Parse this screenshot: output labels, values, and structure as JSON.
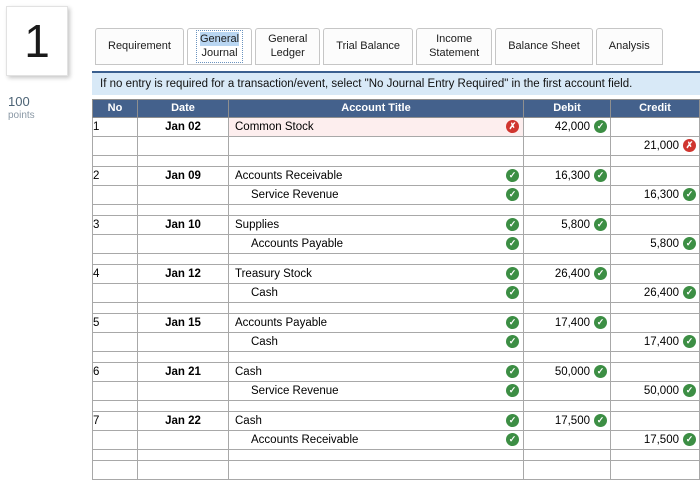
{
  "sidebar": {
    "question_number": "1",
    "points_value": "100",
    "points_label": "points"
  },
  "tabs": {
    "items": [
      {
        "label": "Requirement",
        "selected": false,
        "two_line": false
      },
      {
        "label": "General Journal",
        "selected": true,
        "two_line": true
      },
      {
        "label": "General Ledger",
        "selected": false,
        "two_line": true
      },
      {
        "label": "Trial Balance",
        "selected": false,
        "two_line": false
      },
      {
        "label": "Income Statement",
        "selected": false,
        "two_line": true
      },
      {
        "label": "Balance Sheet",
        "selected": false,
        "two_line": false
      },
      {
        "label": "Analysis",
        "selected": false,
        "two_line": false
      }
    ]
  },
  "notice": {
    "text": "If no entry is required for a transaction/event, select \"No Journal Entry Required\" in the first account field."
  },
  "journal": {
    "columns": [
      "No",
      "Date",
      "Account Title",
      "Debit",
      "Credit"
    ],
    "icons": {
      "ok": "✓",
      "error": "✗"
    },
    "rows": [
      {
        "no": "1",
        "date": "Jan 02",
        "account": "Common Stock",
        "indent": false,
        "account_icon": "error",
        "account_error": true,
        "debit": "42,000",
        "debit_icon": "ok",
        "credit": "",
        "credit_icon": ""
      },
      {
        "no": "",
        "date": "",
        "account": "",
        "indent": false,
        "account_icon": "",
        "account_error": false,
        "debit": "",
        "debit_icon": "",
        "credit": "21,000",
        "credit_icon": "error"
      },
      {
        "type": "spacer"
      },
      {
        "no": "2",
        "date": "Jan 09",
        "account": "Accounts Receivable",
        "indent": false,
        "account_icon": "ok",
        "account_error": false,
        "debit": "16,300",
        "debit_icon": "ok",
        "credit": "",
        "credit_icon": ""
      },
      {
        "no": "",
        "date": "",
        "account": "Service Revenue",
        "indent": true,
        "account_icon": "ok",
        "account_error": false,
        "debit": "",
        "debit_icon": "",
        "credit": "16,300",
        "credit_icon": "ok"
      },
      {
        "type": "spacer"
      },
      {
        "no": "3",
        "date": "Jan 10",
        "account": "Supplies",
        "indent": false,
        "account_icon": "ok",
        "account_error": false,
        "debit": "5,800",
        "debit_icon": "ok",
        "credit": "",
        "credit_icon": ""
      },
      {
        "no": "",
        "date": "",
        "account": "Accounts Payable",
        "indent": true,
        "account_icon": "ok",
        "account_error": false,
        "debit": "",
        "debit_icon": "",
        "credit": "5,800",
        "credit_icon": "ok"
      },
      {
        "type": "spacer"
      },
      {
        "no": "4",
        "date": "Jan 12",
        "account": "Treasury Stock",
        "indent": false,
        "account_icon": "ok",
        "account_error": false,
        "debit": "26,400",
        "debit_icon": "ok",
        "credit": "",
        "credit_icon": ""
      },
      {
        "no": "",
        "date": "",
        "account": "Cash",
        "indent": true,
        "account_icon": "ok",
        "account_error": false,
        "debit": "",
        "debit_icon": "",
        "credit": "26,400",
        "credit_icon": "ok"
      },
      {
        "type": "spacer"
      },
      {
        "no": "5",
        "date": "Jan 15",
        "account": "Accounts Payable",
        "indent": false,
        "account_icon": "ok",
        "account_error": false,
        "debit": "17,400",
        "debit_icon": "ok",
        "credit": "",
        "credit_icon": ""
      },
      {
        "no": "",
        "date": "",
        "account": "Cash",
        "indent": true,
        "account_icon": "ok",
        "account_error": false,
        "debit": "",
        "debit_icon": "",
        "credit": "17,400",
        "credit_icon": "ok"
      },
      {
        "type": "spacer"
      },
      {
        "no": "6",
        "date": "Jan 21",
        "account": "Cash",
        "indent": false,
        "account_icon": "ok",
        "account_error": false,
        "debit": "50,000",
        "debit_icon": "ok",
        "credit": "",
        "credit_icon": ""
      },
      {
        "no": "",
        "date": "",
        "account": "Service Revenue",
        "indent": true,
        "account_icon": "ok",
        "account_error": false,
        "debit": "",
        "debit_icon": "",
        "credit": "50,000",
        "credit_icon": "ok"
      },
      {
        "type": "spacer"
      },
      {
        "no": "7",
        "date": "Jan 22",
        "account": "Cash",
        "indent": false,
        "account_icon": "ok",
        "account_error": false,
        "debit": "17,500",
        "debit_icon": "ok",
        "credit": "",
        "credit_icon": ""
      },
      {
        "no": "",
        "date": "",
        "account": "Accounts Receivable",
        "indent": true,
        "account_icon": "ok",
        "account_error": false,
        "debit": "",
        "debit_icon": "",
        "credit": "17,500",
        "credit_icon": "ok"
      },
      {
        "type": "spacer"
      },
      {
        "no": "",
        "date": "",
        "account": "",
        "indent": false,
        "account_icon": "",
        "account_error": false,
        "debit": "",
        "debit_icon": "",
        "credit": "",
        "credit_icon": ""
      }
    ]
  },
  "colors": {
    "ok_icon": "#3c8e44",
    "error_icon": "#d0352f",
    "header_bg": "#44618c",
    "error_cell_bg": "#fdeeee",
    "notice_bg": "#d8e9f7",
    "notice_border": "#3a5f8f",
    "tab_highlight": "#b9d6f2"
  }
}
